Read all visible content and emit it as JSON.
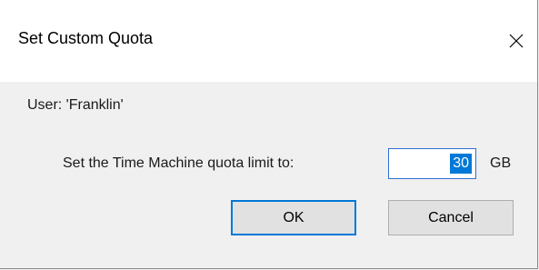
{
  "window": {
    "title": "Set Custom Quota",
    "close_icon": "close-icon"
  },
  "content": {
    "user_text": "User: 'Franklin'",
    "quota_label": "Set the Time Machine quota limit to:",
    "quota_value": "30",
    "quota_unit": "GB"
  },
  "buttons": {
    "ok_label": "OK",
    "cancel_label": "Cancel"
  },
  "colors": {
    "accent": "#0078d7",
    "dialog_background": "#f0f0f0",
    "titlebar_background": "#ffffff"
  }
}
